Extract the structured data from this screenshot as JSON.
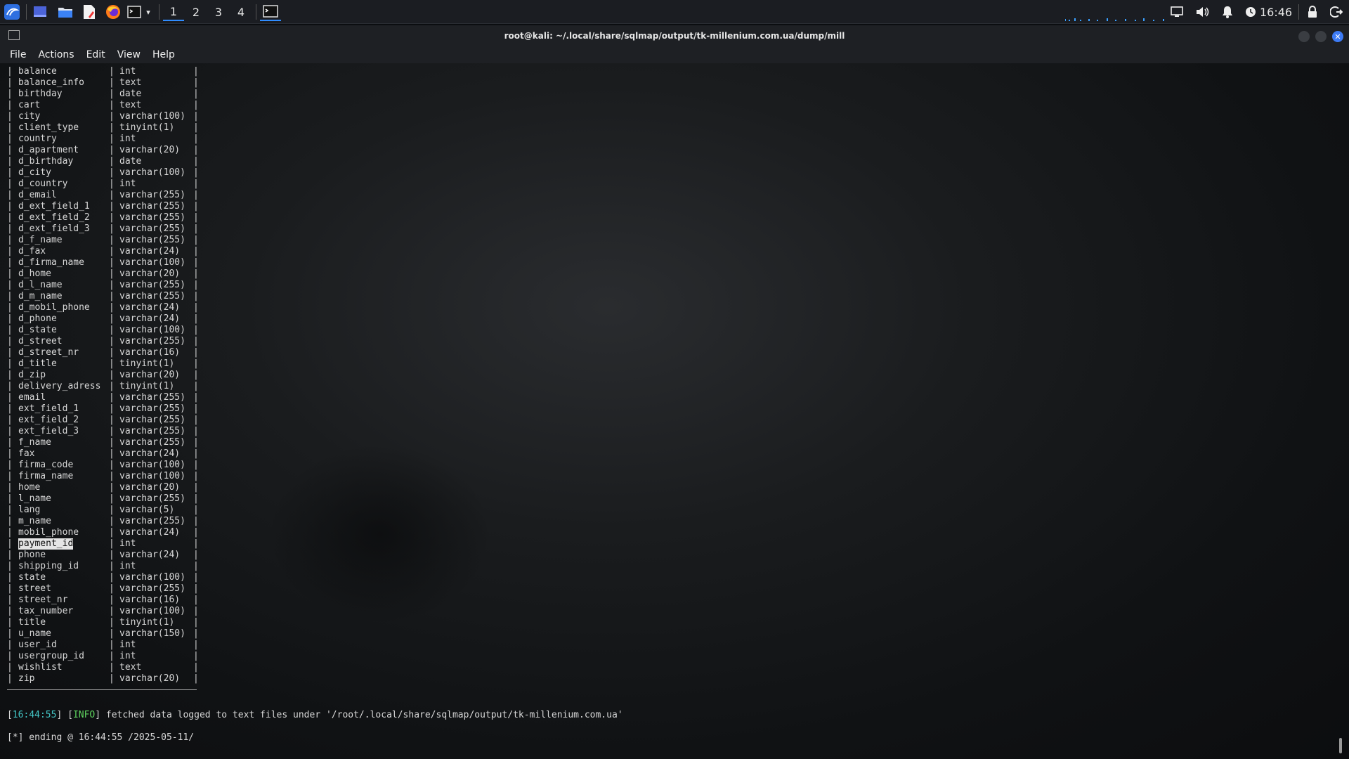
{
  "panel": {
    "workspaces": [
      "1",
      "2",
      "3",
      "4"
    ],
    "active_workspace": "1",
    "clock": "16:46"
  },
  "window": {
    "title": "root@kali: ~/.local/share/sqlmap/output/tk-millenium.com.ua/dump/mill"
  },
  "menu": [
    "File",
    "Actions",
    "Edit",
    "View",
    "Help"
  ],
  "columns": [
    {
      "name": "balance",
      "type": "int"
    },
    {
      "name": "balance_info",
      "type": "text"
    },
    {
      "name": "birthday",
      "type": "date"
    },
    {
      "name": "cart",
      "type": "text"
    },
    {
      "name": "city",
      "type": "varchar(100)"
    },
    {
      "name": "client_type",
      "type": "tinyint(1)"
    },
    {
      "name": "country",
      "type": "int"
    },
    {
      "name": "d_apartment",
      "type": "varchar(20)"
    },
    {
      "name": "d_birthday",
      "type": "date"
    },
    {
      "name": "d_city",
      "type": "varchar(100)"
    },
    {
      "name": "d_country",
      "type": "int"
    },
    {
      "name": "d_email",
      "type": "varchar(255)"
    },
    {
      "name": "d_ext_field_1",
      "type": "varchar(255)"
    },
    {
      "name": "d_ext_field_2",
      "type": "varchar(255)"
    },
    {
      "name": "d_ext_field_3",
      "type": "varchar(255)"
    },
    {
      "name": "d_f_name",
      "type": "varchar(255)"
    },
    {
      "name": "d_fax",
      "type": "varchar(24)"
    },
    {
      "name": "d_firma_name",
      "type": "varchar(100)"
    },
    {
      "name": "d_home",
      "type": "varchar(20)"
    },
    {
      "name": "d_l_name",
      "type": "varchar(255)"
    },
    {
      "name": "d_m_name",
      "type": "varchar(255)"
    },
    {
      "name": "d_mobil_phone",
      "type": "varchar(24)"
    },
    {
      "name": "d_phone",
      "type": "varchar(24)"
    },
    {
      "name": "d_state",
      "type": "varchar(100)"
    },
    {
      "name": "d_street",
      "type": "varchar(255)"
    },
    {
      "name": "d_street_nr",
      "type": "varchar(16)"
    },
    {
      "name": "d_title",
      "type": "tinyint(1)"
    },
    {
      "name": "d_zip",
      "type": "varchar(20)"
    },
    {
      "name": "delivery_adress",
      "type": "tinyint(1)"
    },
    {
      "name": "email",
      "type": "varchar(255)"
    },
    {
      "name": "ext_field_1",
      "type": "varchar(255)"
    },
    {
      "name": "ext_field_2",
      "type": "varchar(255)"
    },
    {
      "name": "ext_field_3",
      "type": "varchar(255)"
    },
    {
      "name": "f_name",
      "type": "varchar(255)"
    },
    {
      "name": "fax",
      "type": "varchar(24)"
    },
    {
      "name": "firma_code",
      "type": "varchar(100)"
    },
    {
      "name": "firma_name",
      "type": "varchar(100)"
    },
    {
      "name": "home",
      "type": "varchar(20)"
    },
    {
      "name": "l_name",
      "type": "varchar(255)"
    },
    {
      "name": "lang",
      "type": "varchar(5)"
    },
    {
      "name": "m_name",
      "type": "varchar(255)"
    },
    {
      "name": "mobil_phone",
      "type": "varchar(24)"
    },
    {
      "name": "payment_id",
      "type": "int",
      "selected": true
    },
    {
      "name": "phone",
      "type": "varchar(24)"
    },
    {
      "name": "shipping_id",
      "type": "int"
    },
    {
      "name": "state",
      "type": "varchar(100)"
    },
    {
      "name": "street",
      "type": "varchar(255)"
    },
    {
      "name": "street_nr",
      "type": "varchar(16)"
    },
    {
      "name": "tax_number",
      "type": "varchar(100)"
    },
    {
      "name": "title",
      "type": "tinyint(1)"
    },
    {
      "name": "u_name",
      "type": "varchar(150)"
    },
    {
      "name": "user_id",
      "type": "int"
    },
    {
      "name": "usergroup_id",
      "type": "int"
    },
    {
      "name": "wishlist",
      "type": "text"
    },
    {
      "name": "zip",
      "type": "varchar(20)"
    }
  ],
  "log": {
    "info_time": "16:44:55",
    "info_tag": "INFO",
    "info_text": " fetched data logged to text files under '/root/.local/share/sqlmap/output/tk-millenium.com.ua'",
    "ending": "[*] ending @ 16:44:55 /2025-05-11/"
  }
}
